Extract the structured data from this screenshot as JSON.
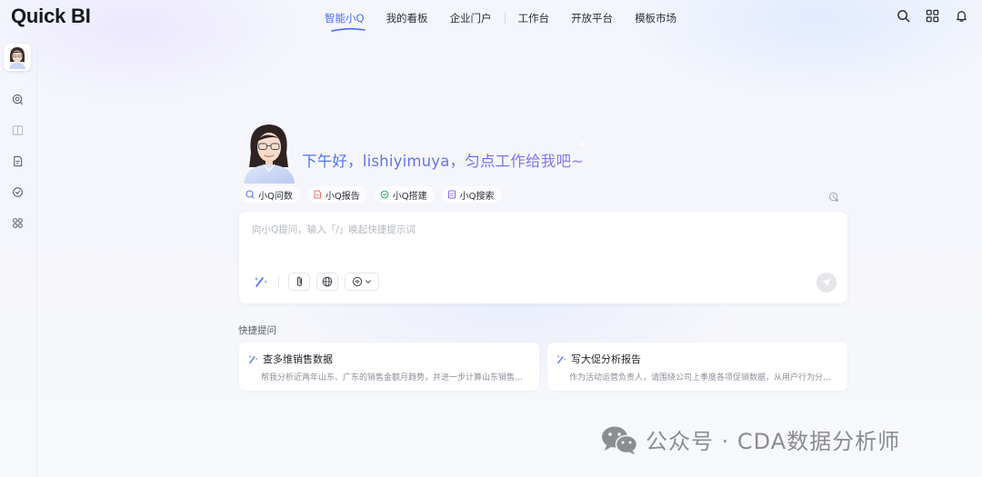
{
  "app": {
    "logo_text": "Quick BI"
  },
  "nav": {
    "items": [
      {
        "label": "智能小Q",
        "active": true
      },
      {
        "label": "我的看板"
      },
      {
        "label": "企业门户"
      },
      {
        "label": "工作台"
      },
      {
        "label": "开放平台"
      },
      {
        "label": "模板市场"
      }
    ]
  },
  "top_icons": [
    "search-icon",
    "grid-apps-icon",
    "bell-icon"
  ],
  "sidebar": {
    "icons": [
      "avatar",
      "qa-chat-icon",
      "book-icon",
      "report-icon",
      "build-icon",
      "apps-icon"
    ]
  },
  "assistant": {
    "greeting": "下午好，lishiyimuya，匀点工作给我吧~"
  },
  "modes": [
    {
      "label": "小Q问数",
      "icon": "qa-chat-icon",
      "color": "#5b7cf6"
    },
    {
      "label": "小Q报告",
      "icon": "report-icon",
      "color": "#f0706f"
    },
    {
      "label": "小Q搭建",
      "icon": "build-icon",
      "color": "#37b27a"
    },
    {
      "label": "小Q搜索",
      "icon": "search-doc-icon",
      "color": "#8a6df0"
    }
  ],
  "input": {
    "placeholder": "向小Q提问，输入「/」唤起快捷提示词",
    "value": ""
  },
  "quick_prompts": {
    "title": "快捷提问",
    "items": [
      {
        "title": "查多维销售数据",
        "desc": "帮我分析近两年山东、广东的销售金额月趋势，并进一步计算山东销售金额同比增长率"
      },
      {
        "title": "写大促分析报告",
        "desc": "作为活动运营负责人，请围绕公司上季度各项促销数据，从用户行为分析、转化率等维度撰写报告"
      }
    ]
  },
  "watermark": {
    "text": "公众号 · CDA数据分析师"
  },
  "colors": {
    "accent": "#4d6bf5",
    "greeting_start": "#4c73f0",
    "greeting_end": "#8f79f0"
  }
}
